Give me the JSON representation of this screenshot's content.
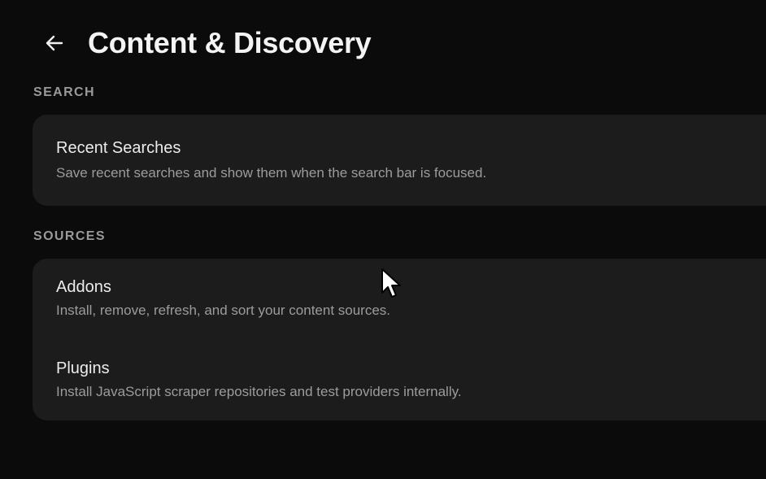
{
  "header": {
    "title": "Content & Discovery",
    "back_icon": "arrow-left-icon"
  },
  "sections": [
    {
      "label": "SEARCH",
      "items": [
        {
          "title": "Recent Searches",
          "description": "Save recent searches and show them when the search bar is focused."
        }
      ]
    },
    {
      "label": "SOURCES",
      "items": [
        {
          "title": "Addons",
          "description": "Install, remove, refresh, and sort your content sources."
        },
        {
          "title": "Plugins",
          "description": "Install JavaScript scraper repositories and test providers internally."
        }
      ]
    }
  ],
  "colors": {
    "background": "#0b0b0b",
    "card": "#1c1c1c",
    "section_label": "#9a9a9a",
    "title": "#ececec",
    "description": "#9c9c9c"
  }
}
